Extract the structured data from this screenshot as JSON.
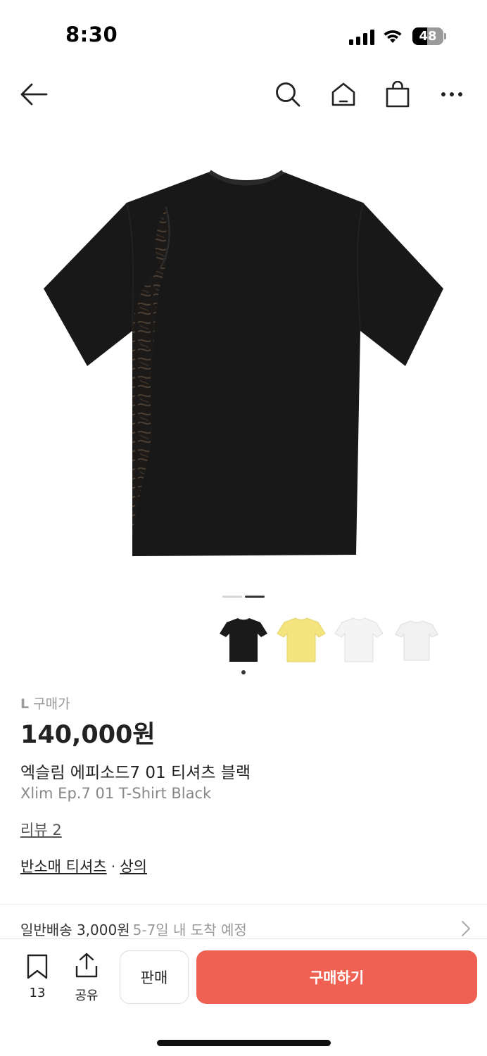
{
  "status_bar": {
    "time": "8:30",
    "battery_level": "48",
    "battery_fraction": 0.48
  },
  "nav": {
    "icons": [
      "back-arrow-icon",
      "search-icon",
      "home-icon",
      "shopping-bag-icon",
      "more-icon"
    ]
  },
  "gallery": {
    "page_count": 2,
    "current_page": 2,
    "thumbnails": [
      {
        "color": "#1a1a1a",
        "selected": true
      },
      {
        "color": "#f3e47e",
        "selected": false
      },
      {
        "color": "#f4f4f4",
        "selected": false
      },
      {
        "color": "#f1f1f1",
        "selected": false
      }
    ]
  },
  "product": {
    "size": "L",
    "price_label": "구매가",
    "price": "140,000원",
    "name_ko": "엑슬림 에피소드7 01 티셔츠 블랙",
    "name_en": "Xlim Ep.7 01 T-Shirt Black",
    "review_link": "리뷰 2",
    "category_primary": "반소매 티셔츠",
    "category_separator": "·",
    "category_secondary": "상의"
  },
  "shipping": {
    "main": "일반배송 3,000원",
    "sub": "5-7일 내 도착 예정"
  },
  "bottom_bar": {
    "wish_count": "13",
    "share_label": "공유",
    "sell_label": "판매",
    "buy_label": "구매하기"
  },
  "colors": {
    "accent": "#ef6253",
    "text_primary": "#222222",
    "text_secondary": "#888888"
  }
}
